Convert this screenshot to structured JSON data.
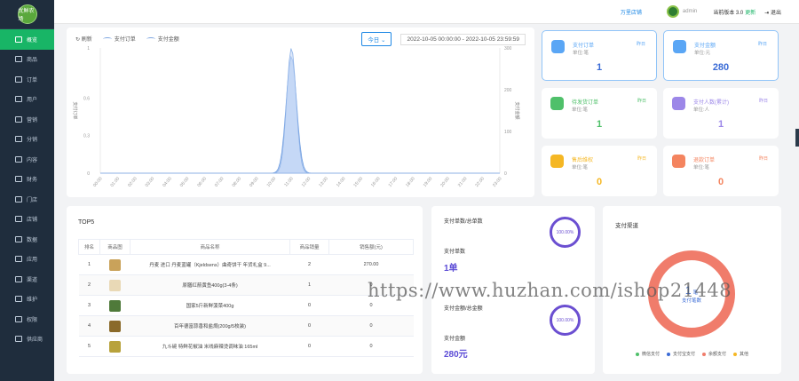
{
  "sidebar": {
    "logo_text": "优鲜农场",
    "items": [
      {
        "label": "概览"
      },
      {
        "label": "商品"
      },
      {
        "label": "订单"
      },
      {
        "label": "用户"
      },
      {
        "label": "营销"
      },
      {
        "label": "分销"
      },
      {
        "label": "内容"
      },
      {
        "label": "财务"
      },
      {
        "label": "门店"
      },
      {
        "label": "店铺"
      },
      {
        "label": "数据"
      },
      {
        "label": "应用"
      },
      {
        "label": "渠道"
      },
      {
        "label": "维护"
      },
      {
        "label": "权限"
      },
      {
        "label": "供应商"
      }
    ]
  },
  "topbar": {
    "store_link": "万里店铺",
    "username": "admin",
    "version_label": "当前版本 3.0",
    "update_label": "更新",
    "logout_label": "退出"
  },
  "chart_panel": {
    "refresh_label": "刷新",
    "legend": [
      "支付订单",
      "支付金额"
    ],
    "range_select": "今日",
    "date_start": "2022-10-05 00:00:00",
    "date_sep": "-",
    "date_end": "2022-10-05 23:59:59"
  },
  "chart_data": {
    "type": "area",
    "series": [
      {
        "name": "支付订单",
        "axis": "left",
        "peak_label": "11:00"
      },
      {
        "name": "支付金额",
        "axis": "right"
      }
    ],
    "x": [
      "00:00",
      "01:00",
      "02:00",
      "03:00",
      "04:00",
      "05:00",
      "06:00",
      "07:00",
      "08:00",
      "09:00",
      "10:00",
      "11:00",
      "12:00",
      "13:00",
      "14:00",
      "15:00",
      "16:00",
      "17:00",
      "18:00",
      "19:00",
      "20:00",
      "21:00",
      "22:00",
      "23:00"
    ],
    "orders": [
      0,
      0,
      0,
      0,
      0,
      0,
      0,
      0,
      0,
      0,
      0,
      1,
      0,
      0,
      0,
      0,
      0,
      0,
      0,
      0,
      0,
      0,
      0,
      0
    ],
    "amount": [
      0,
      0,
      0,
      0,
      0,
      0,
      0,
      0,
      0,
      0,
      0,
      280,
      0,
      0,
      0,
      0,
      0,
      0,
      0,
      0,
      0,
      0,
      0,
      0
    ],
    "y_left_ticks": [
      "0",
      "0.3",
      "0.6",
      "1"
    ],
    "y_right_ticks": [
      "0",
      "100",
      "200",
      "300"
    ],
    "ylabel_left": "支付订单",
    "ylabel_right": "支付金额",
    "ylim_left": [
      0,
      1
    ],
    "ylim_right": [
      0,
      300
    ]
  },
  "stats": [
    {
      "title": "支付订单",
      "sub": "单位:笔",
      "tag": "昨日",
      "value": "1",
      "color": "#5aa6f5"
    },
    {
      "title": "支付金额",
      "sub": "单位:元",
      "tag": "昨日",
      "value": "280",
      "color": "#5aa6f5"
    },
    {
      "title": "待发货订单",
      "sub": "单位:笔",
      "tag": "昨日",
      "value": "1",
      "color": "#4fc06a"
    },
    {
      "title": "支付人数(累计)",
      "sub": "单位:人",
      "tag": "昨日",
      "value": "1",
      "color": "#9c87e8"
    },
    {
      "title": "售后维权",
      "sub": "单位:笔",
      "tag": "昨日",
      "value": "0",
      "color": "#f5b724"
    },
    {
      "title": "退款订单",
      "sub": "单位:笔",
      "tag": "昨日",
      "value": "0",
      "color": "#f4845f"
    }
  ],
  "top5": {
    "title": "TOP5",
    "headers": [
      "排名",
      "商品图",
      "商品名称",
      "商品销量",
      "销售额(元)"
    ],
    "rows": [
      {
        "rank": "1",
        "name": "丹麦 进口 丹麦蓝罐（Kjeldsens）曲奇饼干 年货礼盒 9...",
        "sales": "2",
        "amount": "270.00",
        "thumb": "#c9a25a"
      },
      {
        "rank": "2",
        "name": "原膳红箭黄鱼400g(3-4条)",
        "sales": "1",
        "amount": "0",
        "thumb": "#e9d9b6"
      },
      {
        "rank": "3",
        "name": "国家5斤新鲜菠菜400g",
        "sales": "0",
        "amount": "0",
        "thumb": "#4f7a3a"
      },
      {
        "rank": "4",
        "name": "百年德富蒜香和盐焗(200g/5枚装)",
        "sales": "0",
        "amount": "0",
        "thumb": "#8a6a2a"
      },
      {
        "rank": "5",
        "name": "九斗碗 特鲜花椒油 米线麻辣烫调味油 165ml",
        "sales": "0",
        "amount": "0",
        "thumb": "#b8a23c"
      }
    ]
  },
  "pay": {
    "rate1_title": "支付单数/总单数",
    "rate1_value": "100.00%",
    "count_label": "支付单数",
    "count_value": "1单",
    "rate2_title": "支付金额/总金额",
    "rate2_value": "100.00%",
    "amount_label": "支付金额",
    "amount_value": "280元"
  },
  "channel": {
    "title": "支付渠道",
    "center_value": "1",
    "center_unit": "笔",
    "center_label": "支付笔数",
    "legend": [
      {
        "label": "微信支付",
        "color": "#4fc06a"
      },
      {
        "label": "支付宝支付",
        "color": "#3a6bd6"
      },
      {
        "label": "余额支付",
        "color": "#f07c6b"
      },
      {
        "label": "其他",
        "color": "#f5b724"
      }
    ]
  },
  "watermark": "https://www.huzhan.com/ishop21448"
}
